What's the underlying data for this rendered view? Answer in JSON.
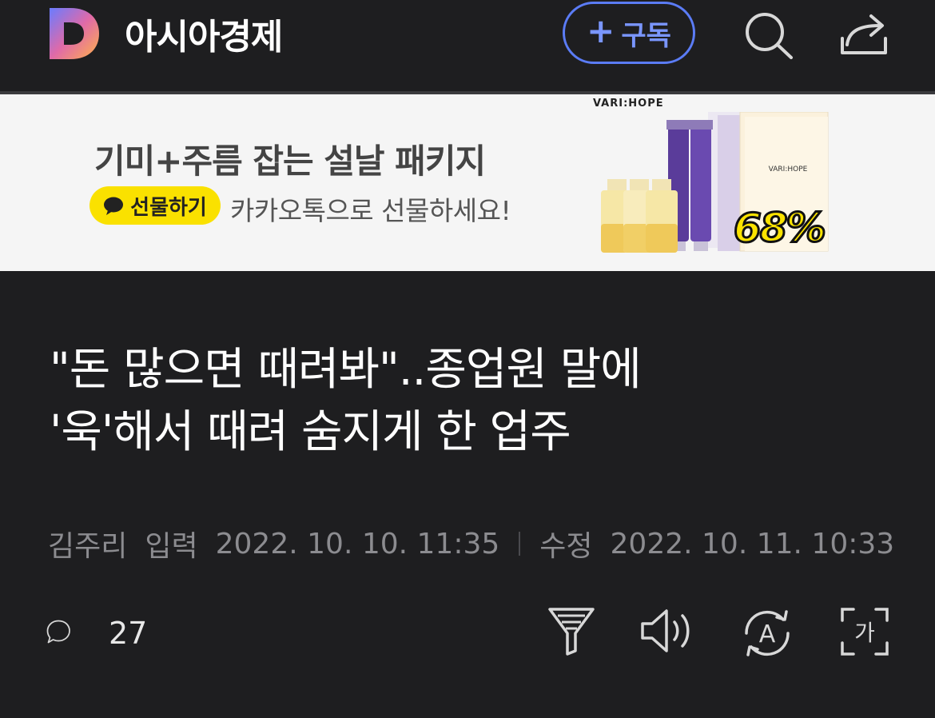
{
  "header": {
    "logo_letter": "D",
    "press_name": "아시아경제",
    "subscribe_label": "구독",
    "subscribe_plus": "+",
    "icons": [
      "search-icon",
      "share-icon"
    ],
    "accent_color": "#5b7cf6"
  },
  "ad": {
    "headline": "기미+주름 잡는 설날 패키지",
    "pill_label": "선물하기",
    "subtext": "카카오톡으로 선물하세요!",
    "brand": "VARI:HOPE",
    "pack_brand": "VARI:HOPE",
    "discount": "68%",
    "pill_color": "#fae100"
  },
  "article": {
    "title_line1": "\"돈 많으면 때려봐\"..종업원 말에",
    "title_line2": "'욱'해서 때려 숨지게 한 업주",
    "author": "김주리",
    "input_label": "입력",
    "input_date": "2022. 10. 10. 11:35",
    "modified_label": "수정",
    "modified_date": "2022. 10. 11. 10:33"
  },
  "toolbar": {
    "comment_count": "27",
    "icons": [
      "comment-icon",
      "summary-icon",
      "speaker-icon",
      "translate-icon",
      "font-size-icon"
    ],
    "translate_glyph": "A",
    "font_size_glyph": "가"
  }
}
